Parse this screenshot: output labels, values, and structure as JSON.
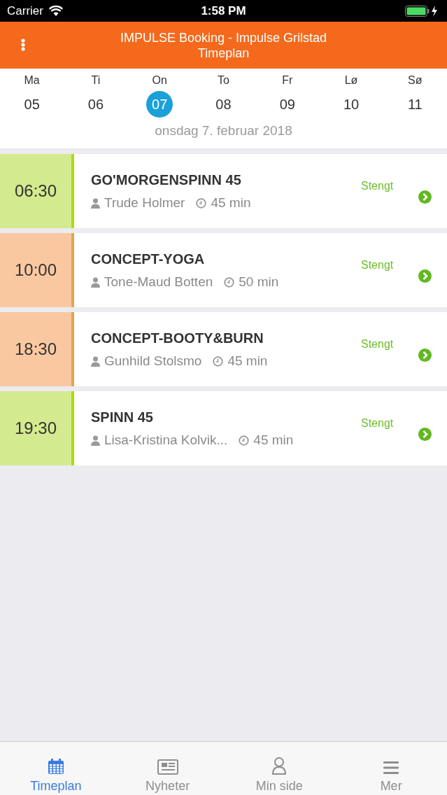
{
  "status_bar": {
    "carrier": "Carrier",
    "time": "1:58 PM"
  },
  "header": {
    "title": "IMPULSE Booking - Impulse Grilstad",
    "subtitle": "Timeplan"
  },
  "week": {
    "days": [
      {
        "weekday": "Ma",
        "date": "05",
        "selected": false
      },
      {
        "weekday": "Ti",
        "date": "06",
        "selected": false
      },
      {
        "weekday": "On",
        "date": "07",
        "selected": true
      },
      {
        "weekday": "To",
        "date": "08",
        "selected": false
      },
      {
        "weekday": "Fr",
        "date": "09",
        "selected": false
      },
      {
        "weekday": "Lø",
        "date": "10",
        "selected": false
      },
      {
        "weekday": "Sø",
        "date": "11",
        "selected": false
      }
    ],
    "full_date": "onsdag 7. februar 2018"
  },
  "sessions": [
    {
      "time": "06:30",
      "color": "#d3ea8e",
      "name": "GO'MORGENSPINN 45",
      "instructor": "Trude  Holmer",
      "duration": "45 min",
      "status": "Stengt"
    },
    {
      "time": "10:00",
      "color": "#fac8a0",
      "name": "CONCEPT-YOGA",
      "instructor": "Tone-Maud Botten",
      "duration": "50 min",
      "status": "Stengt"
    },
    {
      "time": "18:30",
      "color": "#fac8a0",
      "name": "CONCEPT-BOOTY&BURN",
      "instructor": "Gunhild Stolsmo",
      "duration": "45 min",
      "status": "Stengt"
    },
    {
      "time": "19:30",
      "color": "#d3ea8e",
      "name": "SPINN 45",
      "instructor": "Lisa-Kristina Kolvik...",
      "duration": "45 min",
      "status": "Stengt"
    }
  ],
  "tabs": [
    {
      "label": "Timeplan",
      "kind": "calendar",
      "selected": true
    },
    {
      "label": "Nyheter",
      "kind": "news",
      "selected": false
    },
    {
      "label": "Min side",
      "kind": "person",
      "selected": false
    },
    {
      "label": "Mer",
      "kind": "menu",
      "selected": false
    }
  ]
}
